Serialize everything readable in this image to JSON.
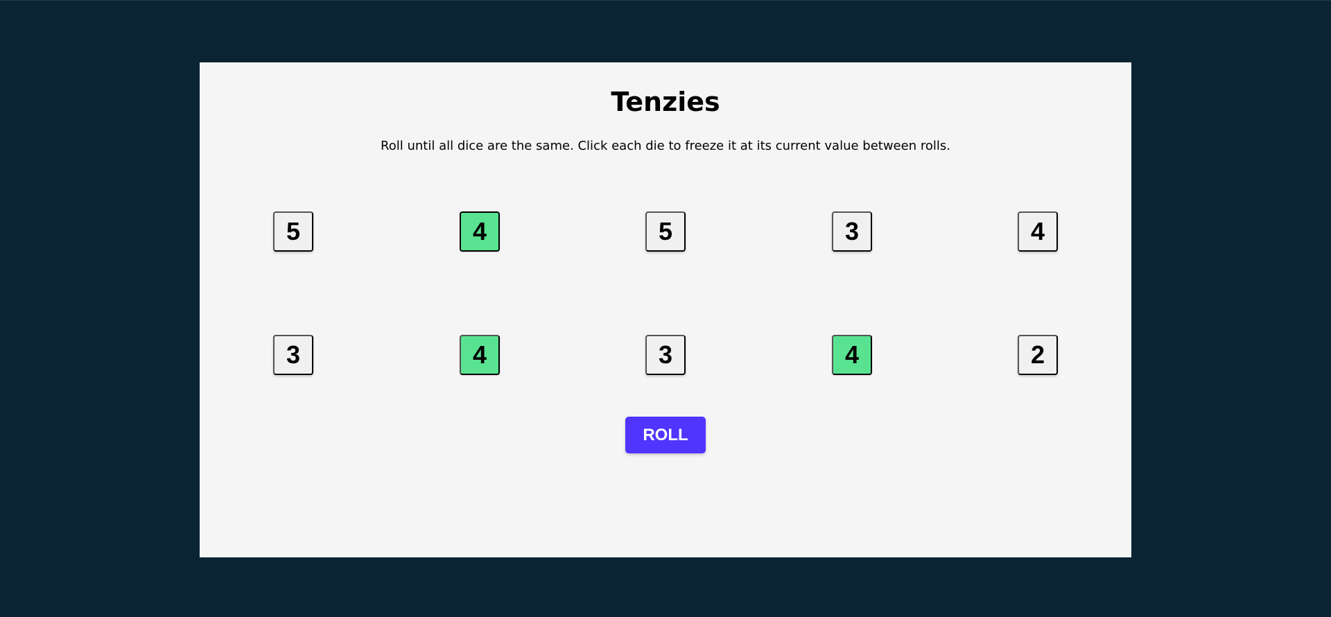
{
  "game": {
    "title": "Tenzies",
    "instructions": "Roll until all dice are the same. Click each die to freeze it at its current value between rolls.",
    "roll_label": "ROLL",
    "held_color": "#59e391",
    "accent_color": "#5035ff",
    "dice": [
      {
        "value": "5",
        "held": false
      },
      {
        "value": "4",
        "held": true
      },
      {
        "value": "5",
        "held": false
      },
      {
        "value": "3",
        "held": false
      },
      {
        "value": "4",
        "held": false
      },
      {
        "value": "3",
        "held": false
      },
      {
        "value": "4",
        "held": true
      },
      {
        "value": "3",
        "held": false
      },
      {
        "value": "4",
        "held": true
      },
      {
        "value": "2",
        "held": false
      }
    ]
  }
}
